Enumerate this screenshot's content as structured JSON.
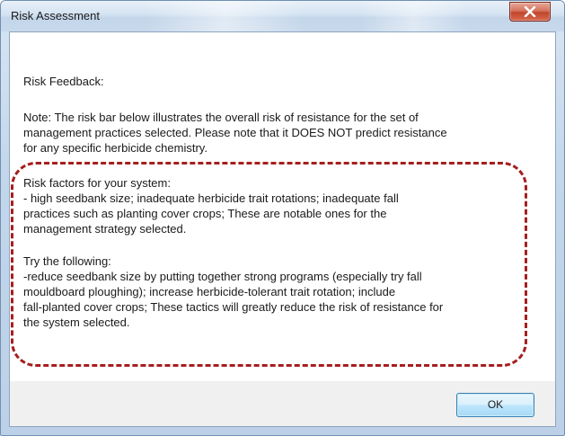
{
  "window": {
    "title": "Risk Assessment",
    "close_icon": "close-x-icon"
  },
  "content": {
    "heading": "Risk Feedback:",
    "note_lines": [
      "Note: The risk bar below illustrates the overall risk of resistance for the set of",
      "management practices selected. Please note that it DOES NOT predict resistance",
      "for any specific herbicide chemistry."
    ],
    "risk_factors_lines": [
      "Risk factors for your system:",
      "- high seedbank size; inadequate herbicide trait rotations; inadequate fall",
      "practices such as planting cover crops; These are notable ones for the",
      "management strategy selected."
    ],
    "try_lines": [
      "Try the following:",
      "-reduce seedbank size by putting together strong programs (especially try fall",
      "mouldboard ploughing); increase herbicide-tolerant trait rotation; include",
      "fall-planted cover crops; These tactics will greatly reduce the risk of resistance for",
      "the system selected."
    ]
  },
  "footer": {
    "ok_label": "OK"
  },
  "colors": {
    "highlight": "#a51f1f",
    "close_button": "#c2452b"
  }
}
